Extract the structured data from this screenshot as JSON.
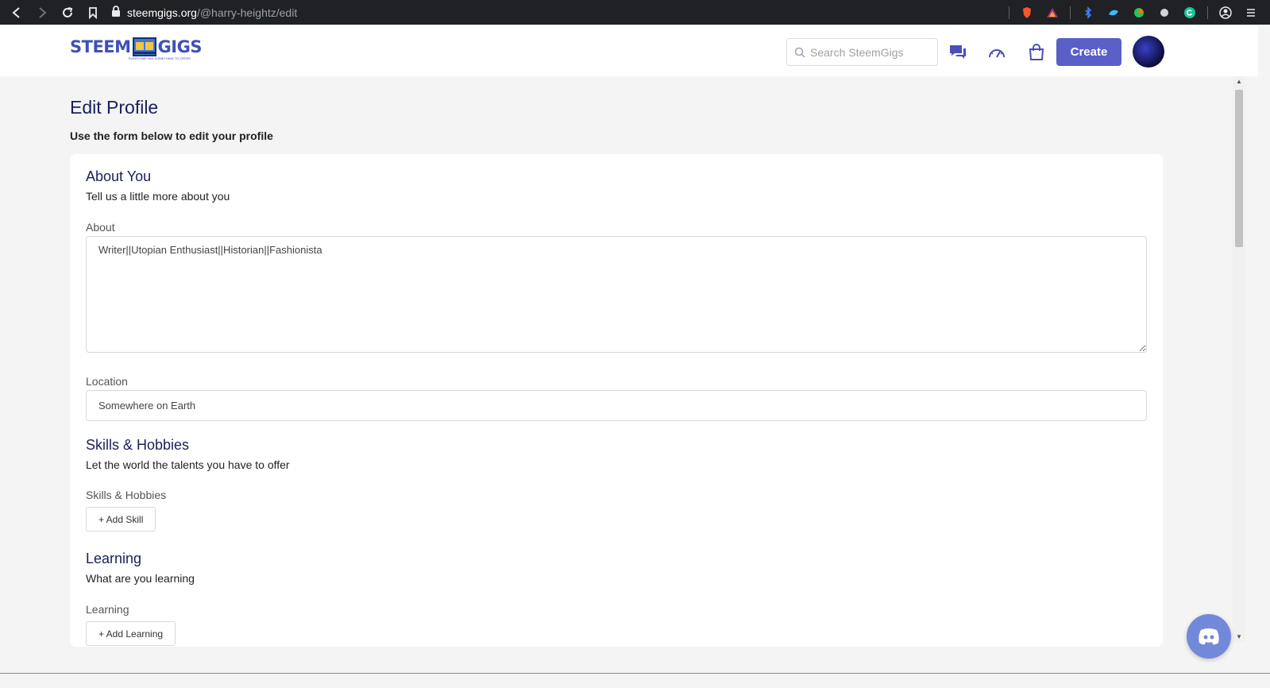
{
  "browser": {
    "url_domain": "steemgigs.org",
    "url_path": "/@harry-heightz/edit"
  },
  "header": {
    "logo_text_left": "STEEM",
    "logo_text_right": "GIGS",
    "logo_tagline": "EVERYONE HAS SOMETHING TO OFFER",
    "search_placeholder": "Search SteemGigs",
    "create_label": "Create",
    "accent": "#5a5fc7"
  },
  "page": {
    "title": "Edit Profile",
    "subtitle": "Use the form below to edit your profile"
  },
  "about": {
    "title": "About You",
    "subtitle": "Tell us a little more about you",
    "about_label": "About",
    "about_value": "Writer||Utopian Enthusiast||Historian||Fashionista",
    "location_label": "Location",
    "location_value": "Somewhere on Earth"
  },
  "skills": {
    "title": "Skills & Hobbies",
    "subtitle": "Let the world the talents you have to offer",
    "label": "Skills & Hobbies",
    "add_label": "+ Add Skill"
  },
  "learning": {
    "title": "Learning",
    "subtitle": "What are you learning",
    "label": "Learning",
    "add_label": "+ Add Learning"
  }
}
